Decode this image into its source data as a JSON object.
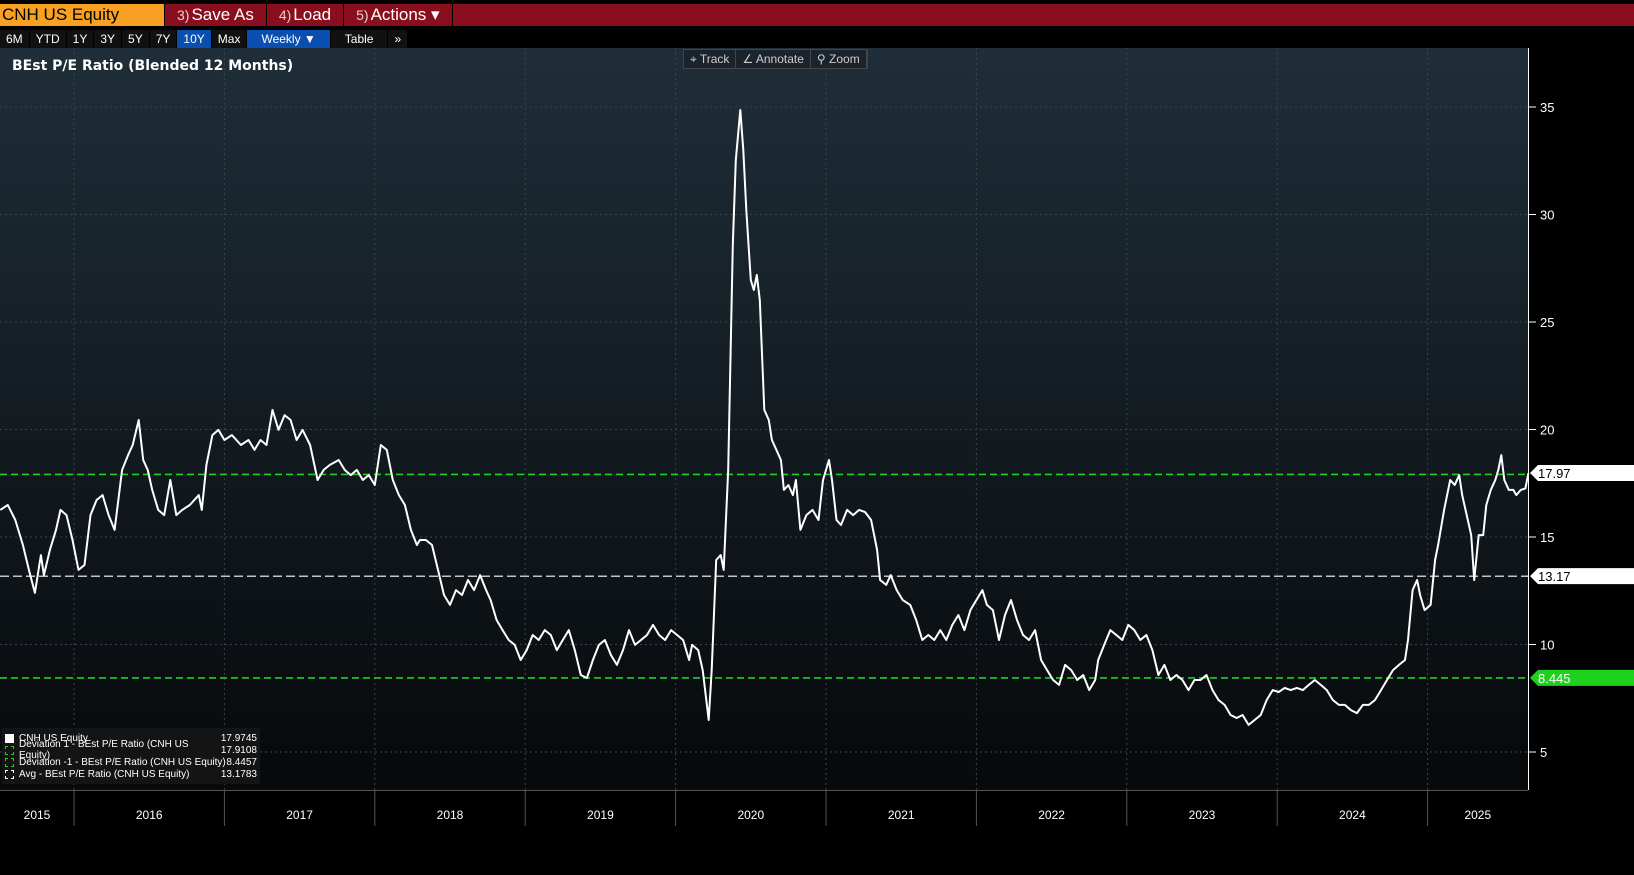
{
  "header": {
    "ticker": "CNH US Equity",
    "buttons": [
      {
        "num": "3)",
        "label": "Save As"
      },
      {
        "num": "4)",
        "label": "Load"
      },
      {
        "num": "5)",
        "label": "Actions ▾"
      }
    ]
  },
  "toolbar": {
    "ranges": [
      "6M",
      "YTD",
      "1Y",
      "3Y",
      "5Y",
      "7Y",
      "10Y",
      "Max"
    ],
    "active_range": "10Y",
    "frequency": "Weekly ▼",
    "table": "Table",
    "more": "»"
  },
  "chart_tools": {
    "track": "⌖ Track",
    "annotate": "∠ Annotate",
    "zoom": "⚲ Zoom"
  },
  "colors": {
    "line": "#ffffff",
    "deviation": "#1fd11f",
    "avg": "#ffffff",
    "header_red": "#8a0f1e",
    "ticker_orange": "#f7a021"
  },
  "legend": [
    {
      "label": "CNH US Equity",
      "value": "17.9745"
    },
    {
      "label": "Deviation 1 - BEst P/E Ratio (CNH US Equity)",
      "value": "17.9108"
    },
    {
      "label": "Deviation -1 - BEst P/E Ratio (CNH US Equity)",
      "value": "8.4457"
    },
    {
      "label": "Avg - BEst P/E Ratio (CNH US Equity)",
      "value": "13.1783"
    }
  ],
  "chart_data": {
    "type": "line",
    "title": "BEst P/E Ratio (Blended 12 Months)",
    "xlabel": "",
    "ylabel": "",
    "ylim": [
      4,
      37.5
    ],
    "yticks": [
      5,
      10,
      15,
      20,
      25,
      30,
      35
    ],
    "xticks": [
      "2015",
      "2016",
      "2017",
      "2018",
      "2019",
      "2020",
      "2021",
      "2022",
      "2023",
      "2024",
      "2025"
    ],
    "grid": true,
    "legend_position": "bottom-left",
    "reference_lines": [
      {
        "name": "Deviation 1",
        "value": 17.9108,
        "style": "green-dashed"
      },
      {
        "name": "Avg",
        "value": 13.1783,
        "style": "white-dashed"
      },
      {
        "name": "Deviation -1",
        "value": 8.4457,
        "style": "green-dashed"
      }
    ],
    "axis_tags": [
      {
        "label": "17.97",
        "value": 17.9745,
        "style": "white"
      },
      {
        "label": "13.17",
        "value": 13.1783,
        "style": "white"
      },
      {
        "label": "8.445",
        "value": 8.4457,
        "style": "green"
      }
    ],
    "series": [
      {
        "name": "CNH US Equity",
        "points": [
          [
            2015.51,
            16.26
          ],
          [
            2015.56,
            16.49
          ],
          [
            2015.61,
            15.79
          ],
          [
            2015.66,
            14.63
          ],
          [
            2015.7,
            13.47
          ],
          [
            2015.74,
            12.4
          ],
          [
            2015.78,
            14.16
          ],
          [
            2015.8,
            13.23
          ],
          [
            2015.84,
            14.4
          ],
          [
            2015.88,
            15.33
          ],
          [
            2015.91,
            16.26
          ],
          [
            2015.95,
            16.02
          ],
          [
            2015.99,
            14.86
          ],
          [
            2016.03,
            13.47
          ],
          [
            2016.07,
            13.7
          ],
          [
            2016.11,
            16.02
          ],
          [
            2016.15,
            16.72
          ],
          [
            2016.19,
            16.95
          ],
          [
            2016.23,
            16.02
          ],
          [
            2016.27,
            15.33
          ],
          [
            2016.32,
            18.12
          ],
          [
            2016.36,
            18.81
          ],
          [
            2016.39,
            19.28
          ],
          [
            2016.43,
            20.44
          ],
          [
            2016.46,
            18.58
          ],
          [
            2016.49,
            18.12
          ],
          [
            2016.52,
            17.19
          ],
          [
            2016.56,
            16.26
          ],
          [
            2016.6,
            16.02
          ],
          [
            2016.64,
            17.65
          ],
          [
            2016.68,
            16.02
          ],
          [
            2016.72,
            16.26
          ],
          [
            2016.77,
            16.49
          ],
          [
            2016.83,
            16.95
          ],
          [
            2016.85,
            16.26
          ],
          [
            2016.88,
            18.35
          ],
          [
            2016.92,
            19.74
          ],
          [
            2016.96,
            19.98
          ],
          [
            2017.0,
            19.51
          ],
          [
            2017.05,
            19.74
          ],
          [
            2017.11,
            19.28
          ],
          [
            2017.16,
            19.51
          ],
          [
            2017.2,
            19.05
          ],
          [
            2017.24,
            19.51
          ],
          [
            2017.28,
            19.28
          ],
          [
            2017.32,
            20.91
          ],
          [
            2017.36,
            19.98
          ],
          [
            2017.4,
            20.67
          ],
          [
            2017.44,
            20.44
          ],
          [
            2017.48,
            19.51
          ],
          [
            2017.52,
            19.98
          ],
          [
            2017.57,
            19.28
          ],
          [
            2017.62,
            17.65
          ],
          [
            2017.66,
            18.12
          ],
          [
            2017.7,
            18.35
          ],
          [
            2017.76,
            18.58
          ],
          [
            2017.8,
            18.12
          ],
          [
            2017.84,
            17.88
          ],
          [
            2017.88,
            18.12
          ],
          [
            2017.92,
            17.65
          ],
          [
            2017.96,
            17.88
          ],
          [
            2018.0,
            17.42
          ],
          [
            2018.04,
            19.28
          ],
          [
            2018.08,
            19.05
          ],
          [
            2018.12,
            17.65
          ],
          [
            2018.16,
            16.95
          ],
          [
            2018.2,
            16.49
          ],
          [
            2018.24,
            15.33
          ],
          [
            2018.28,
            14.63
          ],
          [
            2018.3,
            14.86
          ],
          [
            2018.34,
            14.86
          ],
          [
            2018.38,
            14.63
          ],
          [
            2018.42,
            13.47
          ],
          [
            2018.46,
            12.3
          ],
          [
            2018.5,
            11.84
          ],
          [
            2018.54,
            12.53
          ],
          [
            2018.58,
            12.3
          ],
          [
            2018.62,
            13.0
          ],
          [
            2018.66,
            12.53
          ],
          [
            2018.7,
            13.23
          ],
          [
            2018.74,
            12.53
          ],
          [
            2018.77,
            12.07
          ],
          [
            2018.81,
            11.14
          ],
          [
            2018.85,
            10.67
          ],
          [
            2018.89,
            10.21
          ],
          [
            2018.93,
            9.98
          ],
          [
            2018.97,
            9.28
          ],
          [
            2019.01,
            9.74
          ],
          [
            2019.05,
            10.44
          ],
          [
            2019.09,
            10.21
          ],
          [
            2019.13,
            10.67
          ],
          [
            2019.17,
            10.44
          ],
          [
            2019.21,
            9.74
          ],
          [
            2019.25,
            10.21
          ],
          [
            2019.29,
            10.67
          ],
          [
            2019.33,
            9.74
          ],
          [
            2019.37,
            8.58
          ],
          [
            2019.41,
            8.44
          ],
          [
            2019.45,
            9.28
          ],
          [
            2019.49,
            9.98
          ],
          [
            2019.53,
            10.21
          ],
          [
            2019.57,
            9.51
          ],
          [
            2019.61,
            9.05
          ],
          [
            2019.65,
            9.74
          ],
          [
            2019.69,
            10.67
          ],
          [
            2019.73,
            9.98
          ],
          [
            2019.77,
            10.21
          ],
          [
            2019.81,
            10.44
          ],
          [
            2019.85,
            10.91
          ],
          [
            2019.89,
            10.44
          ],
          [
            2019.93,
            10.21
          ],
          [
            2019.97,
            10.67
          ],
          [
            2020.01,
            10.44
          ],
          [
            2020.05,
            10.21
          ],
          [
            2020.09,
            9.28
          ],
          [
            2020.11,
            9.98
          ],
          [
            2020.15,
            9.74
          ],
          [
            2020.18,
            8.81
          ],
          [
            2020.22,
            6.49
          ],
          [
            2020.24,
            8.81
          ],
          [
            2020.27,
            13.93
          ],
          [
            2020.3,
            14.16
          ],
          [
            2020.32,
            13.47
          ],
          [
            2020.35,
            18.12
          ],
          [
            2020.38,
            28.58
          ],
          [
            2020.4,
            32.53
          ],
          [
            2020.43,
            34.86
          ],
          [
            2020.45,
            33.0
          ],
          [
            2020.47,
            30.21
          ],
          [
            2020.5,
            26.95
          ],
          [
            2020.52,
            26.49
          ],
          [
            2020.54,
            27.19
          ],
          [
            2020.56,
            26.02
          ],
          [
            2020.59,
            20.91
          ],
          [
            2020.62,
            20.44
          ],
          [
            2020.64,
            19.51
          ],
          [
            2020.67,
            19.05
          ],
          [
            2020.7,
            18.58
          ],
          [
            2020.72,
            17.19
          ],
          [
            2020.75,
            17.42
          ],
          [
            2020.78,
            16.95
          ],
          [
            2020.8,
            17.65
          ],
          [
            2020.83,
            15.33
          ],
          [
            2020.87,
            16.02
          ],
          [
            2020.91,
            16.26
          ],
          [
            2020.95,
            15.79
          ],
          [
            2020.98,
            17.65
          ],
          [
            2021.02,
            18.58
          ],
          [
            2021.04,
            17.65
          ],
          [
            2021.07,
            15.79
          ],
          [
            2021.1,
            15.56
          ],
          [
            2021.14,
            16.26
          ],
          [
            2021.18,
            16.02
          ],
          [
            2021.22,
            16.26
          ],
          [
            2021.26,
            16.16
          ],
          [
            2021.3,
            15.79
          ],
          [
            2021.34,
            14.4
          ],
          [
            2021.36,
            13.0
          ],
          [
            2021.4,
            12.77
          ],
          [
            2021.43,
            13.23
          ],
          [
            2021.47,
            12.53
          ],
          [
            2021.51,
            12.07
          ],
          [
            2021.56,
            11.84
          ],
          [
            2021.6,
            11.14
          ],
          [
            2021.64,
            10.21
          ],
          [
            2021.68,
            10.44
          ],
          [
            2021.72,
            10.21
          ],
          [
            2021.76,
            10.67
          ],
          [
            2021.8,
            10.21
          ],
          [
            2021.84,
            10.91
          ],
          [
            2021.88,
            11.37
          ],
          [
            2021.92,
            10.67
          ],
          [
            2021.96,
            11.6
          ],
          [
            2022.0,
            12.07
          ],
          [
            2022.04,
            12.53
          ],
          [
            2022.07,
            11.84
          ],
          [
            2022.11,
            11.6
          ],
          [
            2022.15,
            10.21
          ],
          [
            2022.19,
            11.37
          ],
          [
            2022.23,
            12.07
          ],
          [
            2022.27,
            11.14
          ],
          [
            2022.31,
            10.44
          ],
          [
            2022.35,
            10.21
          ],
          [
            2022.39,
            10.67
          ],
          [
            2022.43,
            9.28
          ],
          [
            2022.47,
            8.81
          ],
          [
            2022.51,
            8.35
          ],
          [
            2022.55,
            8.12
          ],
          [
            2022.59,
            9.05
          ],
          [
            2022.63,
            8.81
          ],
          [
            2022.67,
            8.35
          ],
          [
            2022.71,
            8.58
          ],
          [
            2022.75,
            7.88
          ],
          [
            2022.79,
            8.35
          ],
          [
            2022.81,
            9.28
          ],
          [
            2022.85,
            9.98
          ],
          [
            2022.89,
            10.67
          ],
          [
            2022.93,
            10.44
          ],
          [
            2022.97,
            10.21
          ],
          [
            2023.01,
            10.91
          ],
          [
            2023.05,
            10.67
          ],
          [
            2023.09,
            10.21
          ],
          [
            2023.13,
            10.44
          ],
          [
            2023.17,
            9.74
          ],
          [
            2023.21,
            8.58
          ],
          [
            2023.25,
            9.05
          ],
          [
            2023.29,
            8.35
          ],
          [
            2023.33,
            8.58
          ],
          [
            2023.37,
            8.35
          ],
          [
            2023.41,
            7.88
          ],
          [
            2023.45,
            8.35
          ],
          [
            2023.49,
            8.35
          ],
          [
            2023.53,
            8.58
          ],
          [
            2023.57,
            7.88
          ],
          [
            2023.61,
            7.42
          ],
          [
            2023.65,
            7.19
          ],
          [
            2023.69,
            6.72
          ],
          [
            2023.73,
            6.58
          ],
          [
            2023.77,
            6.72
          ],
          [
            2023.81,
            6.26
          ],
          [
            2023.85,
            6.49
          ],
          [
            2023.89,
            6.72
          ],
          [
            2023.93,
            7.42
          ],
          [
            2023.97,
            7.88
          ],
          [
            2024.01,
            7.79
          ],
          [
            2024.05,
            7.98
          ],
          [
            2024.09,
            7.88
          ],
          [
            2024.13,
            7.98
          ],
          [
            2024.17,
            7.88
          ],
          [
            2024.21,
            8.12
          ],
          [
            2024.25,
            8.35
          ],
          [
            2024.29,
            8.12
          ],
          [
            2024.33,
            7.88
          ],
          [
            2024.37,
            7.42
          ],
          [
            2024.41,
            7.19
          ],
          [
            2024.45,
            7.19
          ],
          [
            2024.49,
            6.95
          ],
          [
            2024.53,
            6.81
          ],
          [
            2024.57,
            7.19
          ],
          [
            2024.61,
            7.19
          ],
          [
            2024.65,
            7.42
          ],
          [
            2024.69,
            7.88
          ],
          [
            2024.73,
            8.35
          ],
          [
            2024.77,
            8.81
          ],
          [
            2024.81,
            9.05
          ],
          [
            2024.85,
            9.28
          ],
          [
            2024.87,
            10.21
          ],
          [
            2024.9,
            12.53
          ],
          [
            2024.93,
            13.0
          ],
          [
            2024.95,
            12.3
          ],
          [
            2024.98,
            11.6
          ],
          [
            2025.02,
            11.84
          ],
          [
            2025.05,
            13.93
          ],
          [
            2025.07,
            14.63
          ],
          [
            2025.11,
            16.26
          ],
          [
            2025.15,
            17.65
          ],
          [
            2025.18,
            17.42
          ],
          [
            2025.21,
            17.88
          ],
          [
            2025.23,
            16.95
          ],
          [
            2025.26,
            16.02
          ],
          [
            2025.29,
            15.09
          ],
          [
            2025.31,
            13.0
          ],
          [
            2025.34,
            15.09
          ],
          [
            2025.37,
            15.09
          ],
          [
            2025.39,
            16.49
          ],
          [
            2025.42,
            17.19
          ],
          [
            2025.45,
            17.65
          ],
          [
            2025.47,
            18.12
          ],
          [
            2025.49,
            18.81
          ],
          [
            2025.51,
            17.65
          ],
          [
            2025.54,
            17.19
          ],
          [
            2025.57,
            17.19
          ],
          [
            2025.59,
            16.95
          ],
          [
            2025.62,
            17.19
          ],
          [
            2025.65,
            17.26
          ],
          [
            2025.67,
            17.97
          ]
        ]
      }
    ]
  }
}
